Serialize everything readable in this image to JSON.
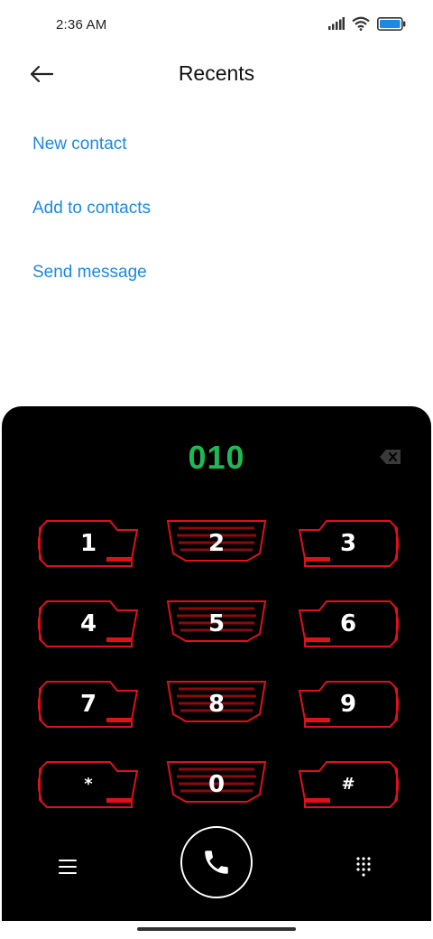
{
  "status_bar": {
    "time": "2:36 AM",
    "icons": [
      "signal-icon",
      "wifi-icon",
      "battery-icon"
    ]
  },
  "header": {
    "title": "Recents",
    "back_icon": "arrow-left-icon"
  },
  "actions": [
    {
      "label": "New contact"
    },
    {
      "label": "Add to contacts"
    },
    {
      "label": "Send message"
    }
  ],
  "dialer": {
    "number": "010",
    "backspace_icon": "backspace-icon",
    "keys": [
      "1",
      "2",
      "3",
      "4",
      "5",
      "6",
      "7",
      "8",
      "9",
      "*",
      "0",
      "#"
    ],
    "menu_icon": "menu-icon",
    "call_icon": "phone-icon",
    "keypad_toggle_icon": "dialpad-grid-icon"
  },
  "colors": {
    "accent": "#1e88e5",
    "number": "#1db954",
    "key_border": "#e0101a",
    "dialer_bg": "#000000"
  }
}
